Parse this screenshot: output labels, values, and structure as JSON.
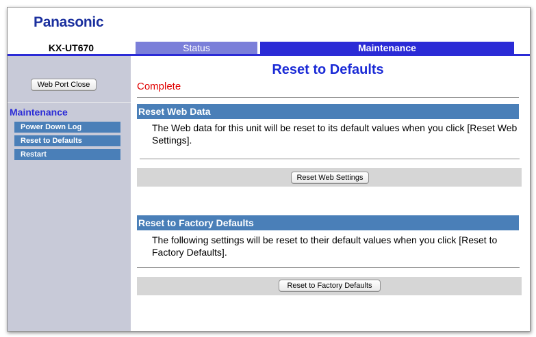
{
  "header": {
    "brand": "Panasonic",
    "model": "KX-UT670"
  },
  "tabs": [
    {
      "label": "Status",
      "active": false
    },
    {
      "label": "Maintenance",
      "active": true
    }
  ],
  "sidebar": {
    "web_port_button": "Web Port Close",
    "section_title": "Maintenance",
    "items": [
      {
        "label": "Power Down Log"
      },
      {
        "label": "Reset to Defaults"
      },
      {
        "label": "Restart"
      }
    ]
  },
  "main": {
    "title": "Reset to Defaults",
    "status": "Complete",
    "sections": [
      {
        "heading": "Reset Web Data",
        "description": "The Web data for this unit will be reset to its default values when you click [Reset Web Settings].",
        "button": "Reset Web Settings"
      },
      {
        "heading": "Reset to Factory Defaults",
        "description": "The following settings will be reset to their default values when you click [Reset to Factory Defaults].",
        "button": "Reset to Factory Defaults"
      }
    ]
  },
  "colors": {
    "brand": "#1a2f9e",
    "tab_inactive": "#7b7fd9",
    "tab_active": "#2b2bd6",
    "section_header": "#4a7fb8",
    "sidebar_bg": "#c8cad8",
    "status_text": "#e00000"
  }
}
